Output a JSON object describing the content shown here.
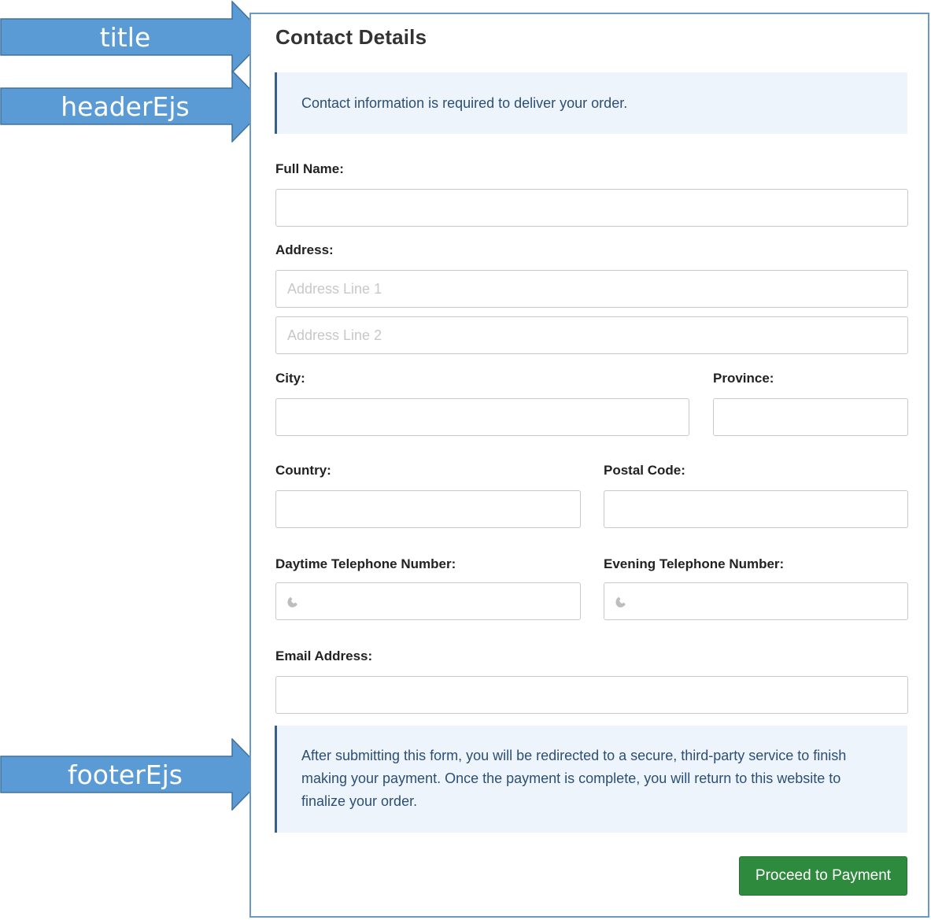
{
  "annotations": {
    "title": "title",
    "header": "headerEjs",
    "footer": "footerEjs"
  },
  "form": {
    "title": "Contact Details",
    "header_notice": "Contact information is required to deliver your order.",
    "fields": {
      "full_name": {
        "label": "Full Name:",
        "value": ""
      },
      "address": {
        "label": "Address:",
        "line1_placeholder": "Address Line 1",
        "line2_placeholder": "Address Line 2"
      },
      "city": {
        "label": "City:",
        "value": ""
      },
      "province": {
        "label": "Province:",
        "value": ""
      },
      "country": {
        "label": "Country:",
        "value": ""
      },
      "postal_code": {
        "label": "Postal Code:",
        "value": ""
      },
      "daytime_phone": {
        "label": "Daytime Telephone Number:",
        "value": ""
      },
      "evening_phone": {
        "label": "Evening Telephone Number:",
        "value": ""
      },
      "email": {
        "label": "Email Address:",
        "value": ""
      }
    },
    "footer_notice": "After submitting this form, you will be redirected to a secure, third-party service to finish making your payment. Once the payment is complete, you will return to this website to finalize your order.",
    "submit_label": "Proceed to Payment"
  },
  "colors": {
    "arrow_fill": "#5b9bd5",
    "panel_border": "#6a98c8",
    "notice_bg": "#edf4fc",
    "notice_accent": "#35608d",
    "button_bg": "#2e8b3e"
  },
  "icons": {
    "phone": "phone-icon"
  }
}
